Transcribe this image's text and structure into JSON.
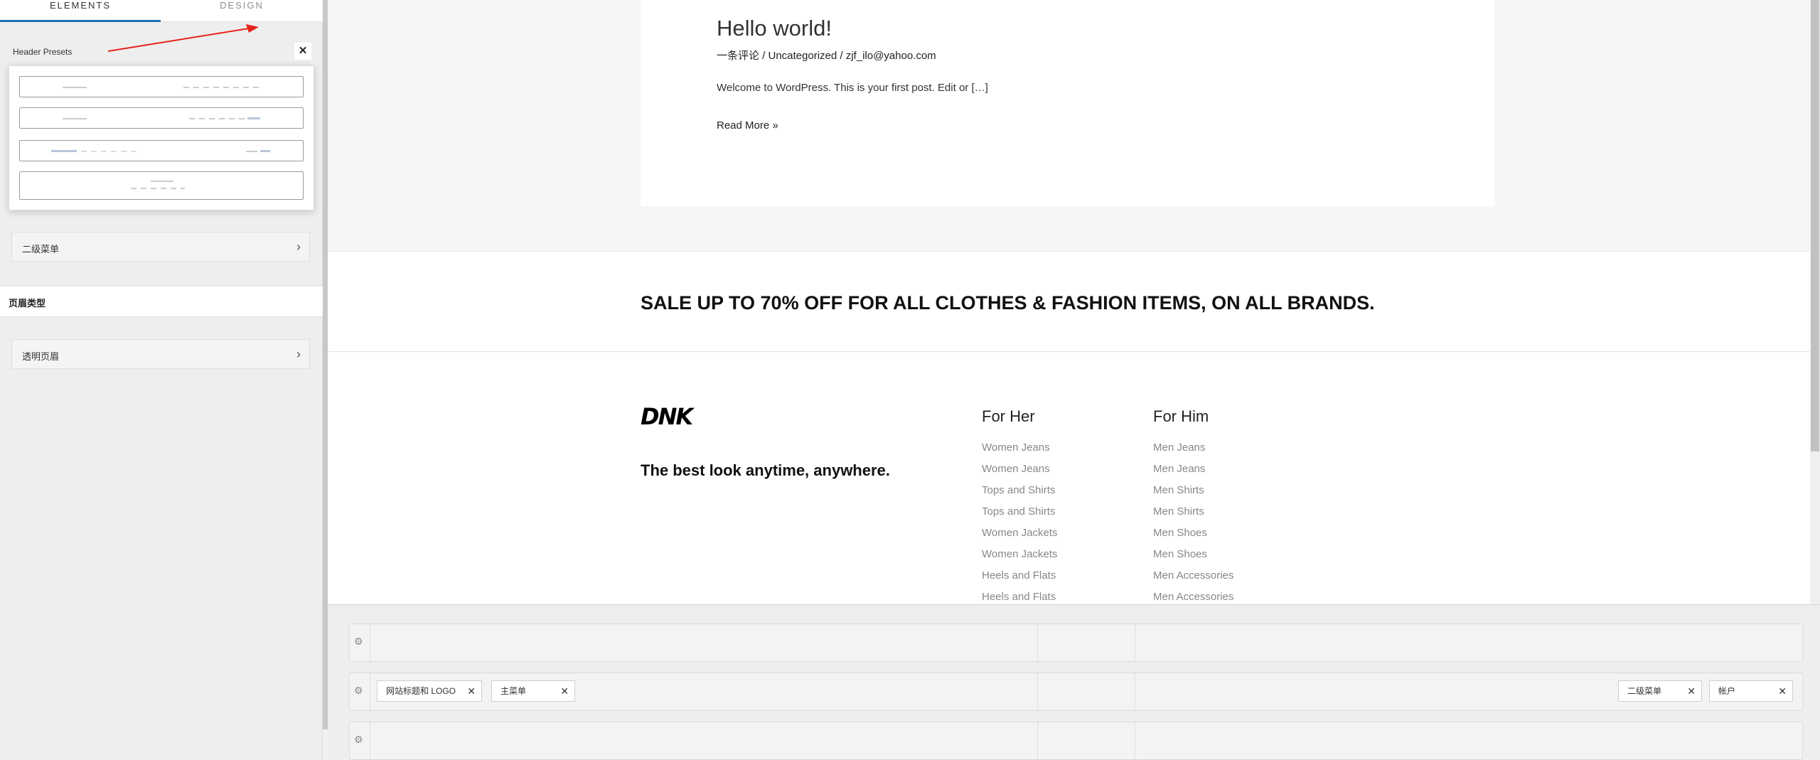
{
  "tabs": {
    "elements": "ELEMENTS",
    "design": "DESIGN"
  },
  "presets": {
    "label": "Header Presets",
    "close": "✕"
  },
  "menu_items": [
    {
      "label": "二级菜单"
    },
    {
      "label": "透明页眉"
    }
  ],
  "section_header": "页眉类型",
  "post": {
    "title": "Hello world!",
    "meta": "一条评论 / Uncategorized / zjf_ilo@yahoo.com",
    "excerpt": "Welcome to WordPress. This is your first post. Edit or […]",
    "read_more": "Read More »"
  },
  "sale": "SALE UP TO 70% OFF FOR ALL CLOTHES & FASHION ITEMS, ON ALL BRANDS.",
  "footer": {
    "logo": "DNK",
    "tagline": "The best look anytime, anywhere.",
    "her": {
      "title": "For Her",
      "items": [
        "Women Jeans",
        "Women Jeans",
        "Tops and Shirts",
        "Tops and Shirts",
        "Women Jackets",
        "Women Jackets",
        "Heels and Flats",
        "Heels and Flats"
      ]
    },
    "him": {
      "title": "For Him",
      "items": [
        "Men Jeans",
        "Men Jeans",
        "Men Shirts",
        "Men Shirts",
        "Men Shoes",
        "Men Shoes",
        "Men Accessories",
        "Men Accessories"
      ]
    }
  },
  "builder": {
    "chips": [
      "网站标题和 LOGO",
      "主菜单",
      "二级菜单",
      "帐户"
    ]
  },
  "colors": {
    "accent": "#2271b1",
    "arrow": "#e8231b"
  }
}
